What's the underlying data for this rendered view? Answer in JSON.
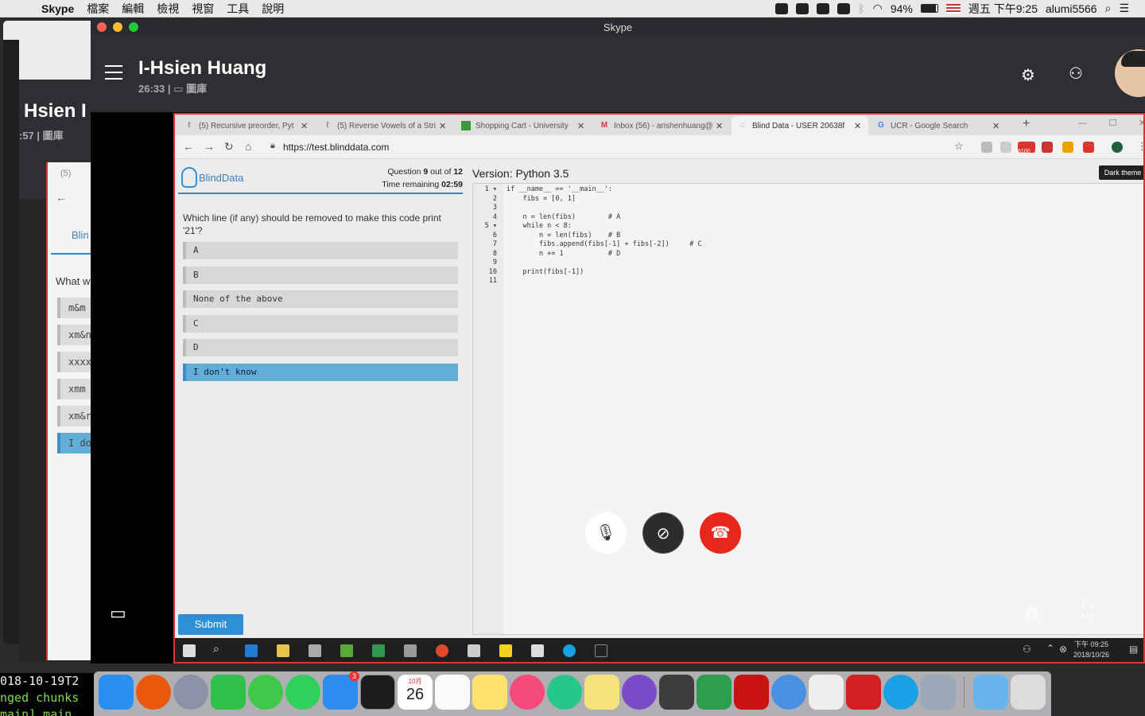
{
  "menubar": {
    "app": "Skype",
    "items": [
      "檔案",
      "編輯",
      "檢視",
      "視窗",
      "工具",
      "說明"
    ],
    "battery": "94%",
    "clock": "週五 下午9:25",
    "user": "alumi5566"
  },
  "skype": {
    "window_title": "Skype",
    "contact_name": "I-Hsien Huang",
    "call_timer": "26:33",
    "separator": "|",
    "gallery_label": "圖庫"
  },
  "bg_window": {
    "name": "Hsien I",
    "timer": ":57",
    "gallery_label": "圖庫",
    "tab_count": "(5)",
    "logo": "Blin",
    "question": "What w",
    "options": [
      "m&m",
      "xm&n",
      "xxxx",
      "xmm",
      "xm&r",
      "I do"
    ]
  },
  "browser": {
    "tabs": [
      {
        "title": "(5) Recursive preorder, Pyt"
      },
      {
        "title": "(5) Reverse Vowels of a Stri"
      },
      {
        "title": "Shopping Cart - University"
      },
      {
        "title": "Inbox (56) - arishenhuang@"
      },
      {
        "title": "Blind Data - USER 20638f"
      },
      {
        "title": "UCR - Google Search"
      }
    ],
    "url": "https://test.blinddata.com",
    "ext_badge": "6100"
  },
  "quiz": {
    "logo": "BlindData",
    "question_prefix": "Question",
    "question_number": "9",
    "question_of": "out of",
    "question_total": "12",
    "time_label": "Time remaining",
    "time_value": "02:59",
    "question_text": "Which line (if any) should be removed to make this code print '21'?",
    "options": [
      "A",
      "B",
      "None of the above",
      "C",
      "D",
      "I don't know"
    ],
    "submit": "Submit"
  },
  "editor": {
    "version": "Version: Python 3.5",
    "dark_theme": "Dark theme",
    "line_numbers": [
      "1 ▾",
      "2",
      "3",
      "4",
      "5 ▾",
      "6",
      "7",
      "8",
      "9",
      "10",
      "11"
    ],
    "lines": [
      "if __name__ == '__main__':",
      "    fibs = [0, 1]",
      "",
      "    n = len(fibs)        # A",
      "    while n < 8:",
      "        n = len(fibs)    # B",
      "        fibs.append(fibs[-1] + fibs[-2])     # C",
      "        n += 1           # D",
      "",
      "    print(fibs[-1])",
      ""
    ]
  },
  "taskbar": {
    "time": "下午 09:25",
    "date": "2018/10/26"
  },
  "dock": {
    "calendar_month": "10月",
    "calendar_day": "26",
    "appstore_badge": "3"
  },
  "terminal": {
    "line1": "018-10-19T2",
    "line2": "nged chunks",
    "line3": "main] main"
  }
}
